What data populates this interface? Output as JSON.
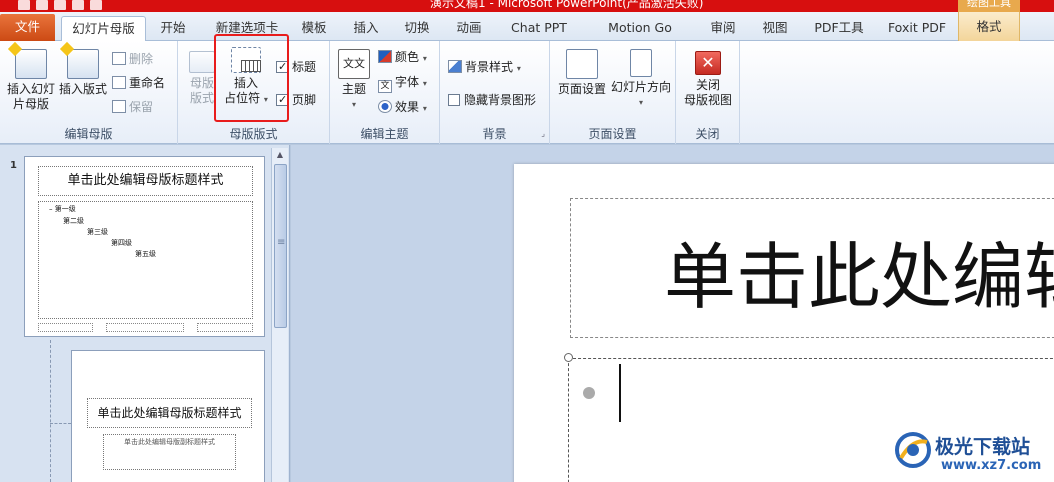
{
  "titlebar": {
    "title": "演示文稿1 - Microsoft PowerPoint(产品激活失败)",
    "context_tools": "绘图工具"
  },
  "tabs": [
    {
      "label": "文件"
    },
    {
      "label": "幻灯片母版"
    },
    {
      "label": "开始"
    },
    {
      "label": "新建选项卡"
    },
    {
      "label": "模板"
    },
    {
      "label": "插入"
    },
    {
      "label": "切换"
    },
    {
      "label": "动画"
    },
    {
      "label": "Chat PPT"
    },
    {
      "label": "Motion Go"
    },
    {
      "label": "审阅"
    },
    {
      "label": "视图"
    },
    {
      "label": "PDF工具"
    },
    {
      "label": "Foxit PDF"
    },
    {
      "label": "格式"
    }
  ],
  "ribbon": {
    "edit_master": {
      "label": "编辑母版",
      "insert_slide_master": "插入幻灯",
      "insert_slide_master_2": "片母版",
      "insert_layout": "插入版式",
      "delete": "删除",
      "rename": "重命名",
      "preserve": "保留"
    },
    "master_layout": {
      "label": "母版版式",
      "master_layout_btn": "母版",
      "master_layout_btn_2": "版式",
      "insert_placeholder": "插入",
      "insert_placeholder_2": "占位符",
      "title_check": "标题",
      "footer_check": "页脚"
    },
    "edit_theme": {
      "label": "编辑主题",
      "theme": "主题",
      "colors": "颜色",
      "fonts": "字体",
      "effects": "效果",
      "theme_icon_text": "文文"
    },
    "background": {
      "label": "背景",
      "bg_styles": "背景样式",
      "hide_bg_graphics": "隐藏背景图形"
    },
    "page_setup": {
      "label": "页面设置",
      "page_setup_btn": "页面设置",
      "orientation": "幻灯片方向"
    },
    "close": {
      "label": "关闭",
      "close_btn": "关闭",
      "close_btn_2": "母版视图"
    }
  },
  "thumbnails": {
    "slide_number": "1",
    "thumb1_title": "单击此处编辑母版标题样式",
    "levels": [
      "第一级",
      "第二级",
      "第三级",
      "第四级",
      "第五级"
    ],
    "thumb2_title": "单击此处编辑母版标题样式",
    "thumb2_subtitle": "单击此处编辑母版副标题样式"
  },
  "slide": {
    "title": "单击此处编辑母版标题样式"
  },
  "watermark": {
    "text": "极光下载站",
    "url": "www.xz7.com"
  }
}
